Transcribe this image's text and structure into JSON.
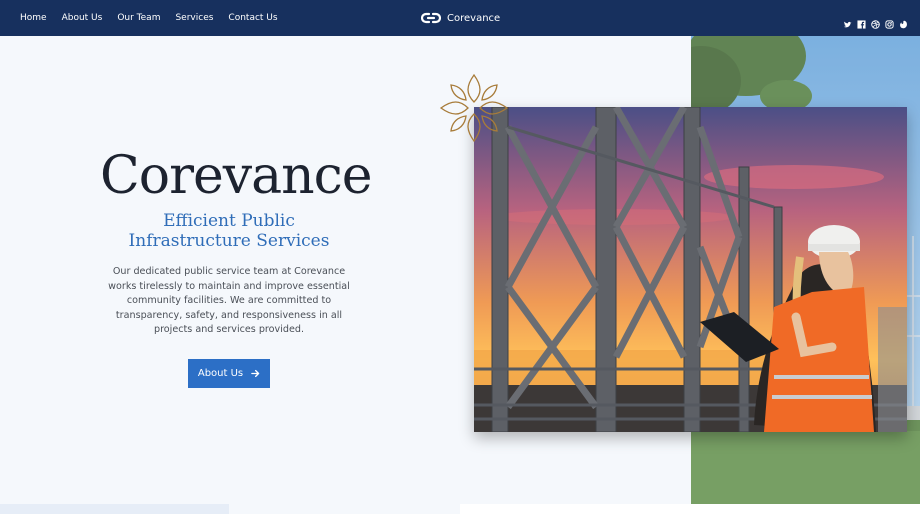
{
  "nav": {
    "links": [
      "Home",
      "About Us",
      "Our Team",
      "Services",
      "Contact Us"
    ],
    "brand": "Corevance",
    "social_icons": [
      "twitter-icon",
      "facebook-icon",
      "dribbble-icon",
      "instagram-icon",
      "pinterest-icon"
    ]
  },
  "hero": {
    "title": "Corevance",
    "subtitle": "Efficient Public Infrastructure Services",
    "description": "Our dedicated public service team at Corevance works tirelessly to maintain and improve essential community facilities. We are committed to transparency, safety, and responsiveness in all projects and services provided.",
    "cta_label": "About Us",
    "cta_icon": "arrow-right-icon"
  },
  "images": {
    "main": "bridge-sunset-engineer-photo",
    "background": "park-power-lines-photo",
    "ornament": "flower-ornament-icon"
  },
  "colors": {
    "nav_bg": "#17305e",
    "accent": "#2c6fc6",
    "subtitle": "#2f6db8",
    "ornament": "#a87c3a",
    "page_bg": "#f5f8fc"
  }
}
